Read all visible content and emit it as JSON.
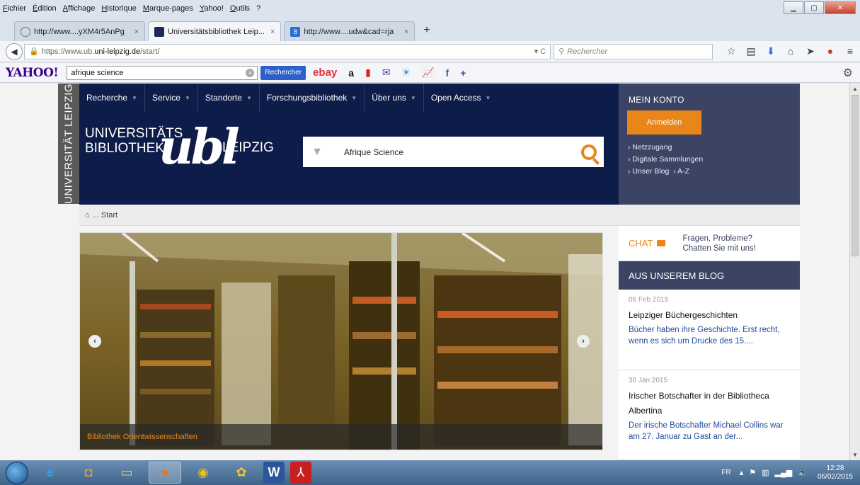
{
  "menu": [
    "Fichier",
    "Édition",
    "Affichage",
    "Historique",
    "Marque-pages",
    "Yahoo!",
    "Outils",
    "?"
  ],
  "tabs": [
    {
      "label": "http://www....yXM4r5AnPg",
      "close": "×"
    },
    {
      "label": "Universitätsbibliothek Leip...",
      "close": "×"
    },
    {
      "label": "http://www....udw&cad=rja",
      "close": "×"
    }
  ],
  "newtab": "+",
  "url": {
    "prefix": "https://www.ub.",
    "host": "uni-leipzig.de",
    "path": "/start/"
  },
  "search_placeholder": "Rechercher",
  "yahoo": {
    "logo": "YAHOO!",
    "query": "afrique science",
    "button": "Rechercher",
    "ebay": "ebay",
    "amazon": "a"
  },
  "site": {
    "vertical_label": "UNIVERSITÄT LEIPZIG",
    "nav": [
      "Recherche",
      "Service",
      "Standorte",
      "Forschungsbibliothek",
      "Über uns",
      "Open Access"
    ],
    "logo_line1": "UNIVERSITÄTS",
    "logo_line2": "BIBLIOTHEK",
    "logo_ubl": "ubl",
    "logo_leipzig": "LEIPZIG",
    "search_value": "Afrique Science",
    "konto": {
      "title": "MEIN KONTO",
      "login": "Anmelden",
      "links": [
        "› Netzzugang",
        "› Digitale Sammlungen",
        "› Unser Blog",
        "› A-Z"
      ]
    },
    "breadcrumb": "... Start",
    "slide_caption": "Bibliothek Orientwissenschaften",
    "chat": {
      "label": "CHAT",
      "line1": "Fragen, Probleme?",
      "line2": "Chatten Sie mit uns!"
    },
    "blog_title": "AUS UNSEREM BLOG",
    "blog": [
      {
        "date": "06 Feb 2015",
        "title": "Leipziger Büchergeschichten",
        "excerpt": "Bücher haben ihre Geschichte. Erst recht, wenn es sich um Drucke des 15...."
      },
      {
        "date": "30 Jan 2015",
        "title": "Irischer Botschafter in der Bibliotheca Albertina",
        "excerpt": "Der irische Botschafter Michael Collins war am 27. Januar zu Gast an der..."
      }
    ]
  },
  "taskbar": {
    "lang": "FR",
    "time": "12:28",
    "date": "06/02/2015"
  },
  "colors": {
    "navy": "#0e1c4a",
    "orange": "#e8861a",
    "slate": "#3b4464"
  }
}
